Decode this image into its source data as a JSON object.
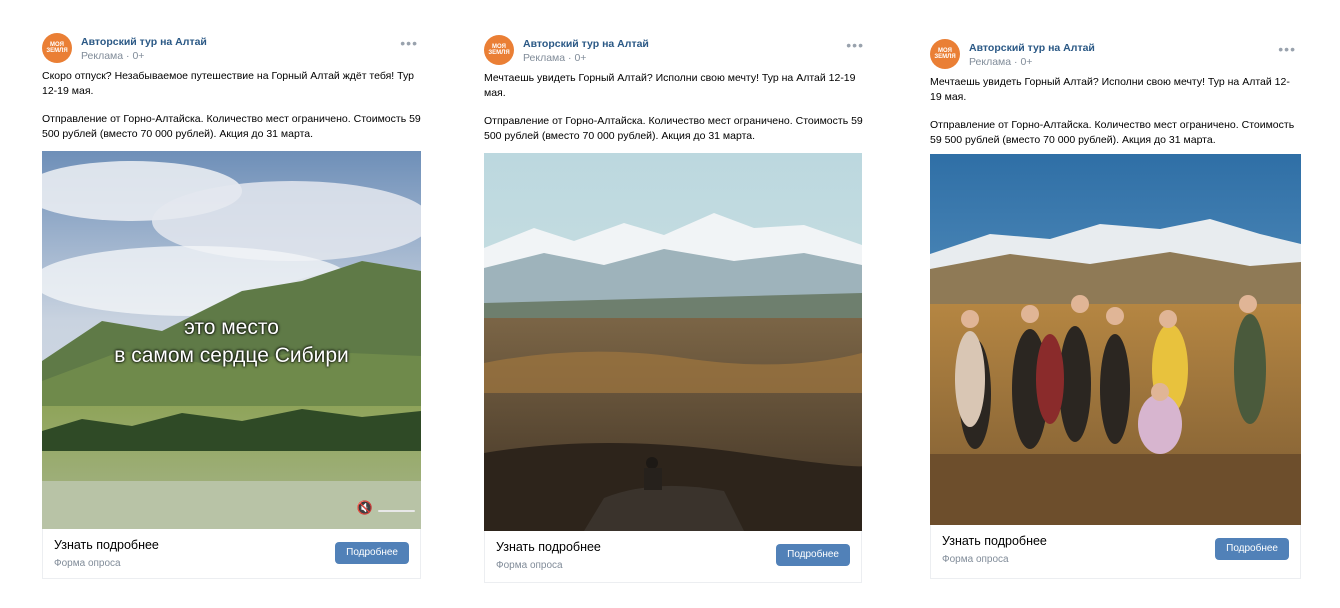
{
  "posts": [
    {
      "avatar": "МОЯ ЗЕМЛЯ",
      "author": "Авторский тур на Алтай",
      "meta": "Реклама · 0+",
      "text1": "Скоро отпуск? Незабываемое путешествие на Горный Алтай ждёт тебя! Тур 12-19 мая.",
      "text2": "Отправление от Горно-Алтайска. Количество мест ограничено. Стоимость 59 500 рублей (вместо 70 000 рублей). Акция до 31 марта.",
      "overlay_line1": "это место",
      "overlay_line2": "в самом сердце Сибири",
      "cta_title": "Узнать подробнее",
      "cta_sub": "Форма опроса",
      "cta_button": "Подробнее"
    },
    {
      "avatar": "МОЯ ЗЕМЛЯ",
      "author": "Авторский тур на Алтай",
      "meta": "Реклама · 0+",
      "text1": "Мечтаешь увидеть Горный Алтай? Исполни свою мечту! Тур на Алтай 12-19 мая.",
      "text2": "Отправление от Горно-Алтайска. Количество мест ограничено. Стоимость 59 500 рублей (вместо 70 000 рублей). Акция до 31 марта.",
      "cta_title": "Узнать подробнее",
      "cta_sub": "Форма опроса",
      "cta_button": "Подробнее"
    },
    {
      "avatar": "МОЯ ЗЕМЛЯ",
      "author": "Авторский тур на Алтай",
      "meta": "Реклама · 0+",
      "text1": "Мечтаешь увидеть Горный Алтай? Исполни свою мечту! Тур на Алтай 12-19 мая.",
      "text2": "Отправление от Горно-Алтайска. Количество мест ограничено. Стоимость 59 500 рублей (вместо 70 000 рублей). Акция до 31 марта.",
      "cta_title": "Узнать подробнее",
      "cta_sub": "Форма опроса",
      "cta_button": "Подробнее"
    }
  ],
  "colors": {
    "link": "#2a5885",
    "button": "#5181b8",
    "avatar": "#ea7f35"
  }
}
